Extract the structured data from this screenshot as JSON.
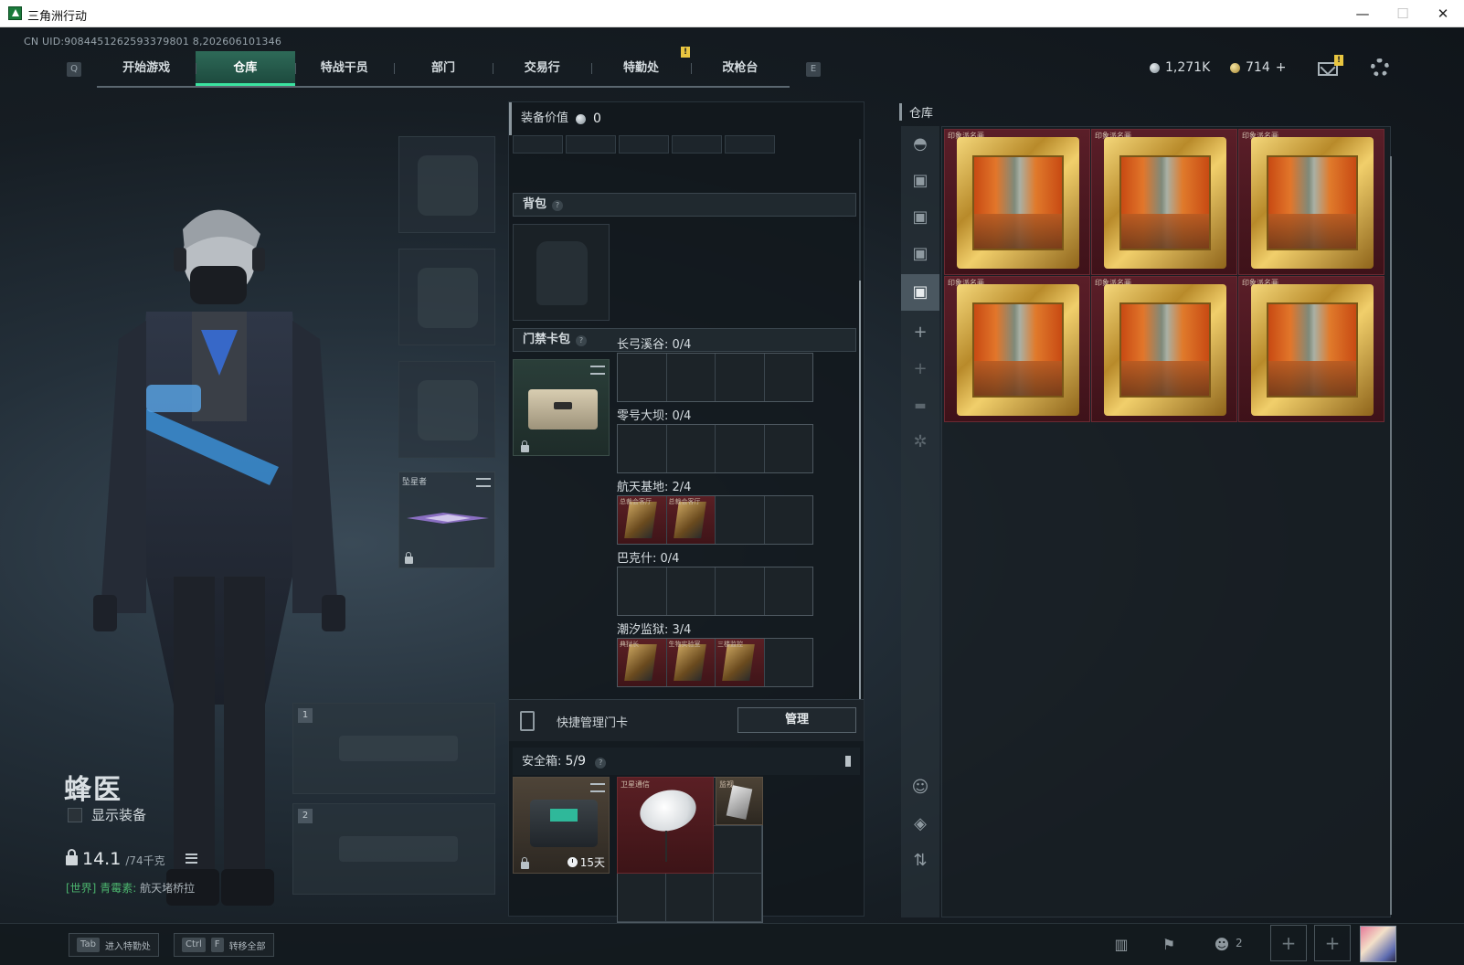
{
  "window": {
    "title": "三角洲行动",
    "minimize": "—",
    "maximize": "☐",
    "close": "✕"
  },
  "uid": "CN UID:9084451262593379801 8,202606101346",
  "nav": {
    "key_left": "Q",
    "key_right": "E",
    "tabs": [
      "开始游戏",
      "仓库",
      "特战干员",
      "部门",
      "交易行",
      "特勤处",
      "改枪台"
    ],
    "active_tab": "仓库",
    "badge": "!"
  },
  "currency": {
    "silver": "1,271K",
    "gold": "714",
    "gold_add": "+",
    "mail_badge": "!"
  },
  "character": {
    "name": "蜂医",
    "show_equipment_label": "显示装备",
    "weight_current": "14.1",
    "weight_max": "/74千克",
    "chat_channel": "[世界]",
    "chat_user": "青霉素:",
    "chat_message": "航天堵桥拉"
  },
  "equipment": {
    "melee_label": "坠星者",
    "weapon_slot_1": "1",
    "weapon_slot_2": "2"
  },
  "middle": {
    "equip_value_label": "装备价值",
    "equip_value": "0",
    "backpack_label": "背包",
    "keycard_label": "门禁卡包",
    "help": "?",
    "maps": [
      {
        "title": "长弓溪谷: 0/4",
        "filled": 0,
        "labels": []
      },
      {
        "title": "零号大坝: 0/4",
        "filled": 0,
        "labels": []
      },
      {
        "title": "航天基地: 2/4",
        "filled": 2,
        "labels": [
          "总裁会客厅",
          "总裁会客厅"
        ]
      },
      {
        "title": "巴克什: 0/4",
        "filled": 0,
        "labels": []
      },
      {
        "title": "潮汐监狱: 3/4",
        "filled": 3,
        "labels": [
          "典狱长",
          "生物实验室",
          "三楼监控"
        ]
      }
    ],
    "quick_manage_label": "快捷管理门卡",
    "manage_button": "管理",
    "safebox_label": "安全箱:",
    "safebox_count": "5/9",
    "safebox_timer": "15天",
    "satellite_label": "卫星通信",
    "monitor_label": "监视"
  },
  "warehouse": {
    "title": "仓库",
    "painting_label": "印象派名画",
    "painting_count": 6,
    "sidebar_icons": [
      "helmet-icon",
      "camera-icon",
      "camera-icon",
      "camera-icon",
      "camera-active-icon",
      "plus-icon",
      "plus-icon",
      "lock-icon",
      "gear-icon",
      "person-icon",
      "layers-icon",
      "sort-icon"
    ]
  },
  "bottom": {
    "hint1_key": "Tab",
    "hint1_text": "进入特勤处",
    "hint2_key1": "Ctrl",
    "hint2_key2": "F",
    "hint2_text": "转移全部",
    "friends_count": "2"
  }
}
